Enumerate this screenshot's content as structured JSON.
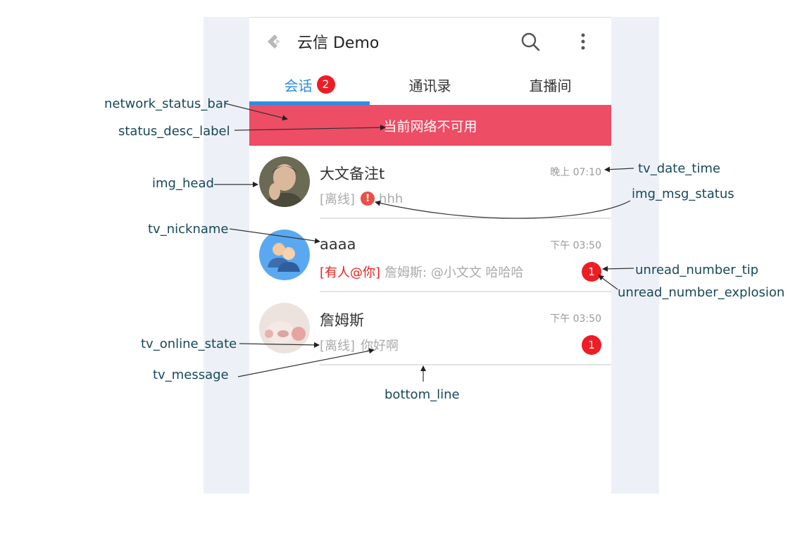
{
  "app": {
    "title": "云信 Demo"
  },
  "tabs": [
    {
      "label": "会话",
      "badge": "2",
      "active": true
    },
    {
      "label": "通讯录",
      "active": false
    },
    {
      "label": "直播间",
      "active": false
    }
  ],
  "network_bar": {
    "text": "当前网络不可用",
    "color": "#ed4d65"
  },
  "sessions": [
    {
      "nickname": "大文备注t",
      "time": "晚上 07:10",
      "online_state": "[离线]",
      "message": "hhh",
      "msg_status": "!",
      "avatar": "photo-avatar"
    },
    {
      "nickname": "aaaa",
      "time": "下午 03:50",
      "at_tag": "[有人@你]",
      "message": "詹姆斯: @小文文 哈哈哈",
      "unread": "1",
      "avatar": "group-avatar"
    },
    {
      "nickname": "詹姆斯",
      "time": "下午 03:50",
      "online_state": "[离线]",
      "message": "你好啊",
      "unread": "1",
      "avatar": "photo-avatar"
    }
  ],
  "annotations": {
    "network_status_bar": "network_status_bar",
    "status_desc_label": "status_desc_label",
    "img_head": "img_head",
    "tv_nickname": "tv_nickname",
    "tv_online_state": "tv_online_state",
    "tv_message": "tv_message",
    "tv_date_time": "tv_date_time",
    "img_msg_status": "img_msg_status",
    "unread_number_tip": "unread_number_tip",
    "unread_number_explosion": "unread_number_explosion",
    "bottom_line": "bottom_line"
  },
  "colors": {
    "accent": "#2a8de8",
    "badge": "#ee1c24",
    "label_text": "#17485a"
  }
}
